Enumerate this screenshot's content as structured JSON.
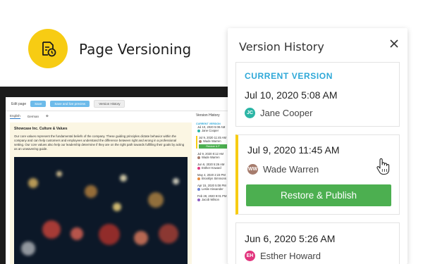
{
  "hero": {
    "title": "Page Versioning",
    "icon": "page-clock-icon",
    "badge_color": "#f7cc13"
  },
  "editor": {
    "toolbar": {
      "title": "Edit page",
      "buttons": [
        "Save",
        "Save and live preview",
        "Version History"
      ]
    },
    "tabs": [
      "English",
      "German"
    ],
    "content": {
      "title": "Showcase Inc. Culture & Values",
      "paragraph": "Our core values represent the fundamental beliefs of the company. These guiding principles dictate behavior within the company and can help customers and employees understand the difference between right and wrong in a professional setting. Our core values also help our leadership determine if they are on the right path towards fulfilling their goals by acting as an unwavering guide."
    },
    "sidebar": {
      "title": "Version History",
      "current_label": "CURRENT VERSION",
      "restore_label": "Restore & P",
      "entries": [
        {
          "date": "Jul 10, 2020 5:08 AM",
          "user": "Jane Cooper",
          "color": "#2bb5a5"
        },
        {
          "date": "Jul 9, 2020 11:45 AM",
          "user": "Wade Warren",
          "color": "#a67c6d"
        },
        {
          "date": "Jul 9, 2020 8:12 AM",
          "user": "Wade Warren",
          "color": "#a67c6d"
        },
        {
          "date": "Jun 6, 2020 5:26 AM",
          "user": "Esther Howard",
          "color": "#e2357e"
        },
        {
          "date": "May 4, 2020 2:23 PM",
          "user": "Brooklyn Simmons",
          "color": "#e88a3b"
        },
        {
          "date": "Apr 15, 2020 5:08 PM",
          "user": "Leslie Alexander",
          "color": "#6d82d6"
        },
        {
          "date": "Feb 28, 2020 9:01 PM",
          "user": "Jacob Wilson",
          "color": "#8e5fc4"
        }
      ]
    }
  },
  "version_panel": {
    "title": "Version History",
    "current_label": "CURRENT VERSION",
    "restore_button": "Restore & Publish",
    "versions": [
      {
        "date": "Jul 10, 2020 5:08 AM",
        "user": "Jane Cooper",
        "initials": "JC",
        "avatar_color": "#2bb5a5"
      },
      {
        "date": "Jul 9, 2020 11:45 AM",
        "user": "Wade Warren",
        "initials": "WW",
        "avatar_color": "#a67c6d"
      },
      {
        "date": "Jun 6, 2020 5:26 AM",
        "user": "Esther Howard",
        "initials": "EH",
        "avatar_color": "#e2357e"
      }
    ],
    "selected_accent": "#f7cc13",
    "button_color": "#4caf50",
    "current_label_color": "#2ea8d8"
  }
}
